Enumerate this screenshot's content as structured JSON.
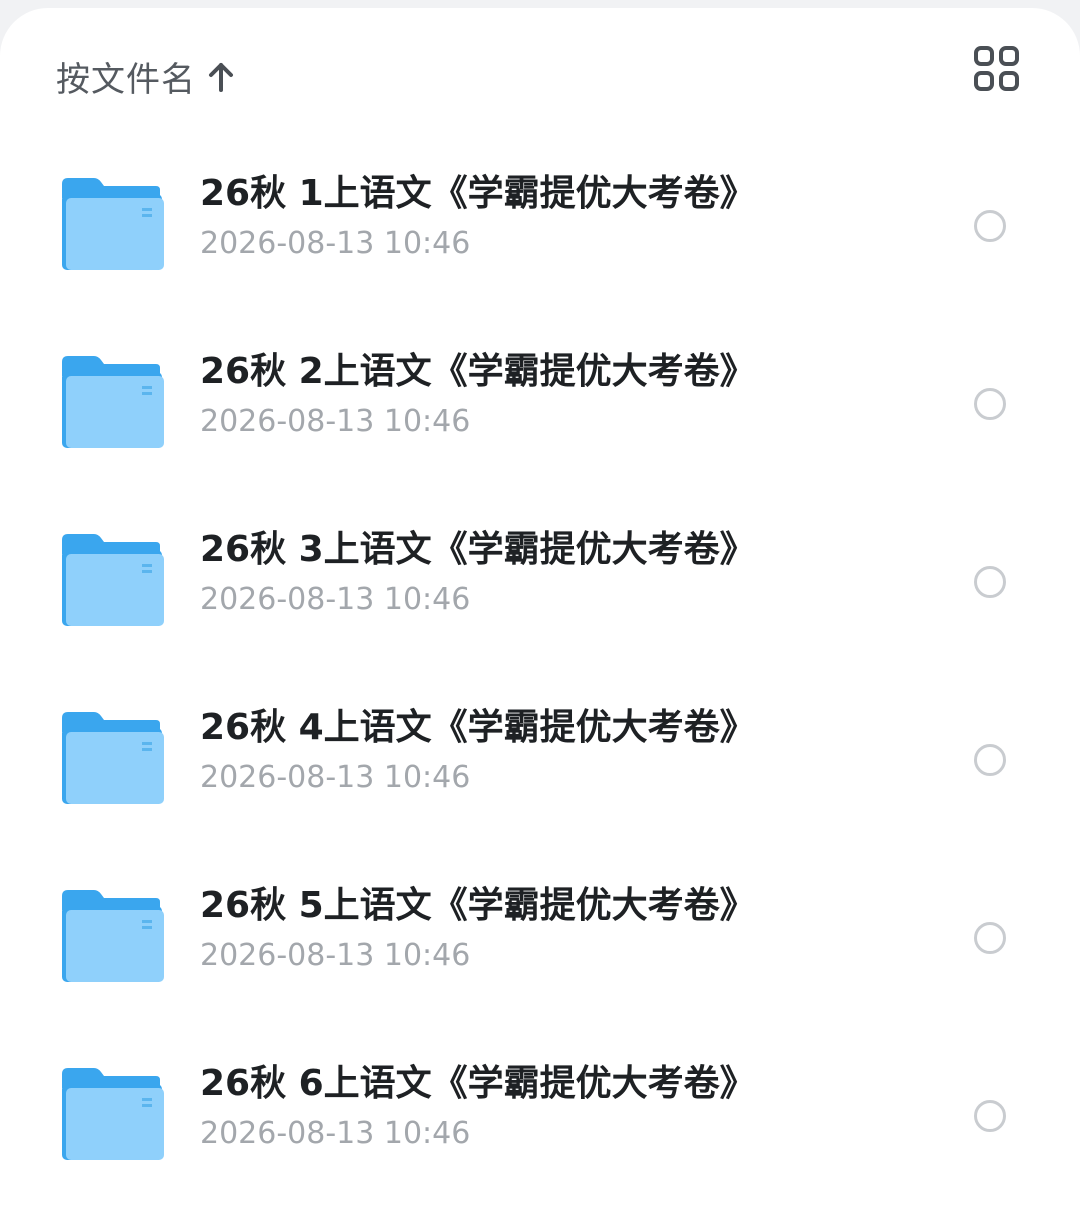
{
  "header": {
    "sort_label": "按文件名",
    "sort_direction_icon": "arrow-up-icon",
    "view_toggle_icon": "grid-view-icon"
  },
  "colors": {
    "folder_back": "#3aa6ee",
    "folder_front": "#8fd0fb",
    "title_text": "#1e2124",
    "date_text": "#a3a7ac",
    "radio_border": "#c9ccd0"
  },
  "files": [
    {
      "name": "26秋 1上语文《学霸提优大考卷》",
      "modified": "2026-08-13 10:46",
      "icon": "folder-icon"
    },
    {
      "name": "26秋 2上语文《学霸提优大考卷》",
      "modified": "2026-08-13 10:46",
      "icon": "folder-icon"
    },
    {
      "name": "26秋 3上语文《学霸提优大考卷》",
      "modified": "2026-08-13 10:46",
      "icon": "folder-icon"
    },
    {
      "name": "26秋 4上语文《学霸提优大考卷》",
      "modified": "2026-08-13 10:46",
      "icon": "folder-icon"
    },
    {
      "name": "26秋 5上语文《学霸提优大考卷》",
      "modified": "2026-08-13 10:46",
      "icon": "folder-icon"
    },
    {
      "name": "26秋 6上语文《学霸提优大考卷》",
      "modified": "2026-08-13 10:46",
      "icon": "folder-icon"
    }
  ]
}
